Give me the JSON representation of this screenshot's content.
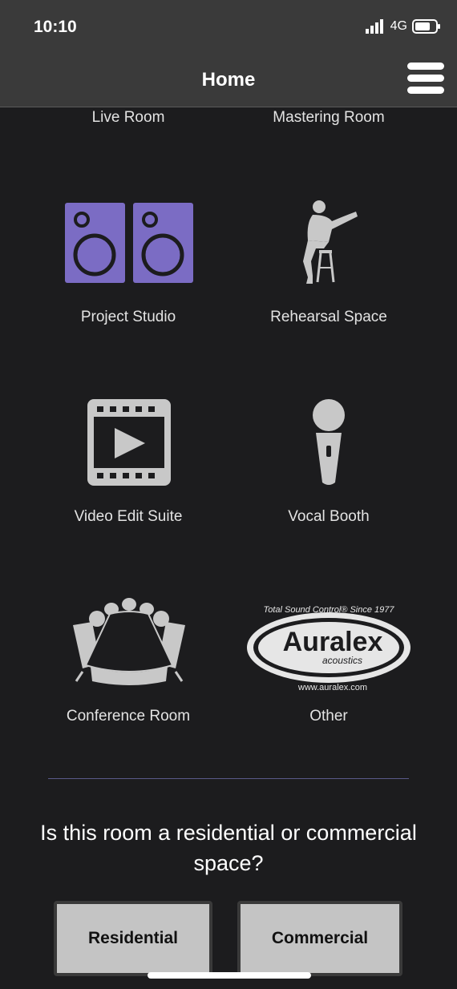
{
  "status": {
    "time": "10:10",
    "network": "4G"
  },
  "nav": {
    "title": "Home"
  },
  "rooms": {
    "live_room": "Live Room",
    "mastering_room": "Mastering Room",
    "project_studio": "Project Studio",
    "rehearsal_space": "Rehearsal Space",
    "video_edit_suite": "Video Edit Suite",
    "vocal_booth": "Vocal Booth",
    "conference_room": "Conference Room",
    "other": "Other"
  },
  "logo": {
    "top_text": "Total Sound Control® Since 1977",
    "brand": "Auralex",
    "sub": "acoustics",
    "url": "www.auralex.com"
  },
  "question": "Is this room a residential or commercial space?",
  "buttons": {
    "residential": "Residential",
    "commercial": "Commercial"
  },
  "colors": {
    "speaker_purple": "#7b6cc4",
    "icon_gray": "#c8c8c8",
    "divider": "#595a8a"
  }
}
